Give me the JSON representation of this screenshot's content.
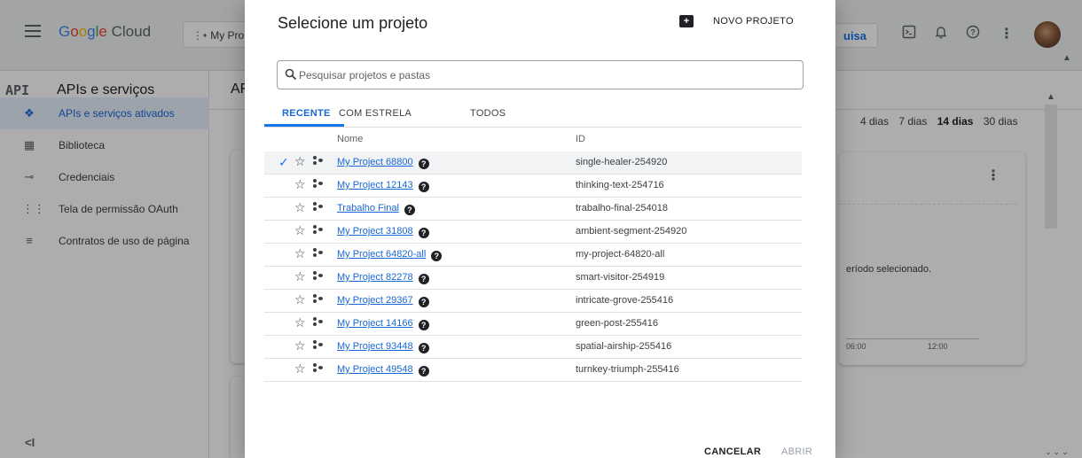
{
  "topbar": {
    "product_name": "Google Cloud",
    "project_picker_label": "My Pro",
    "search_button": "uisa"
  },
  "sidebar": {
    "header_mark": "API",
    "title": "APIs e serviços",
    "items": [
      {
        "label": "APIs e serviços ativados",
        "icon": "api-diamond-icon",
        "active": true
      },
      {
        "label": "Biblioteca",
        "icon": "library-grid-icon",
        "active": false
      },
      {
        "label": "Credenciais",
        "icon": "key-icon",
        "active": false
      },
      {
        "label": "Tela de permissão OAuth",
        "icon": "oauth-consent-icon",
        "active": false
      },
      {
        "label": "Contratos de uso de página",
        "icon": "settings-list-icon",
        "active": false
      }
    ],
    "collapse_label": "<I"
  },
  "main": {
    "header_fragment": "AF",
    "time_ranges": [
      "4 dias",
      "7 dias",
      "14 dias",
      "30 dias"
    ],
    "selected_range": "14 dias",
    "card_message": "eríodo selecionado.",
    "axis_ticks": [
      "06:00",
      "12:00"
    ]
  },
  "dialog": {
    "title": "Selecione um projeto",
    "new_project_label": "NOVO PROJETO",
    "search_placeholder": "Pesquisar projetos e pastas",
    "tabs": [
      {
        "label": "RECENTE",
        "active": true
      },
      {
        "label": "COM ESTRELA",
        "active": false
      },
      {
        "label": "TODOS",
        "active": false
      }
    ],
    "columns": {
      "name": "Nome",
      "id": "ID"
    },
    "projects": [
      {
        "name": "My Project 68800",
        "id": "single-healer-254920",
        "selected": true
      },
      {
        "name": "My Project 12143",
        "id": "thinking-text-254716",
        "selected": false
      },
      {
        "name": "Trabalho Final",
        "id": "trabalho-final-254018",
        "selected": false
      },
      {
        "name": "My Project 31808",
        "id": "ambient-segment-254920",
        "selected": false
      },
      {
        "name": "My Project 64820-all",
        "id": "my-project-64820-all",
        "selected": false
      },
      {
        "name": "My Project 82278",
        "id": "smart-visitor-254919",
        "selected": false
      },
      {
        "name": "My Project 29367",
        "id": "intricate-grove-255416",
        "selected": false
      },
      {
        "name": "My Project 14166",
        "id": "green-post-255416",
        "selected": false
      },
      {
        "name": "My Project 93448",
        "id": "spatial-airship-255416",
        "selected": false
      },
      {
        "name": "My Project 49548",
        "id": "turnkey-triumph-255416",
        "selected": false
      }
    ],
    "cancel_label": "CANCELAR",
    "open_label": "ABRIR"
  },
  "colors": {
    "accent": "#1a73e8",
    "link": "#1967d2",
    "scrim": "rgba(0,0,0,0.32)"
  }
}
